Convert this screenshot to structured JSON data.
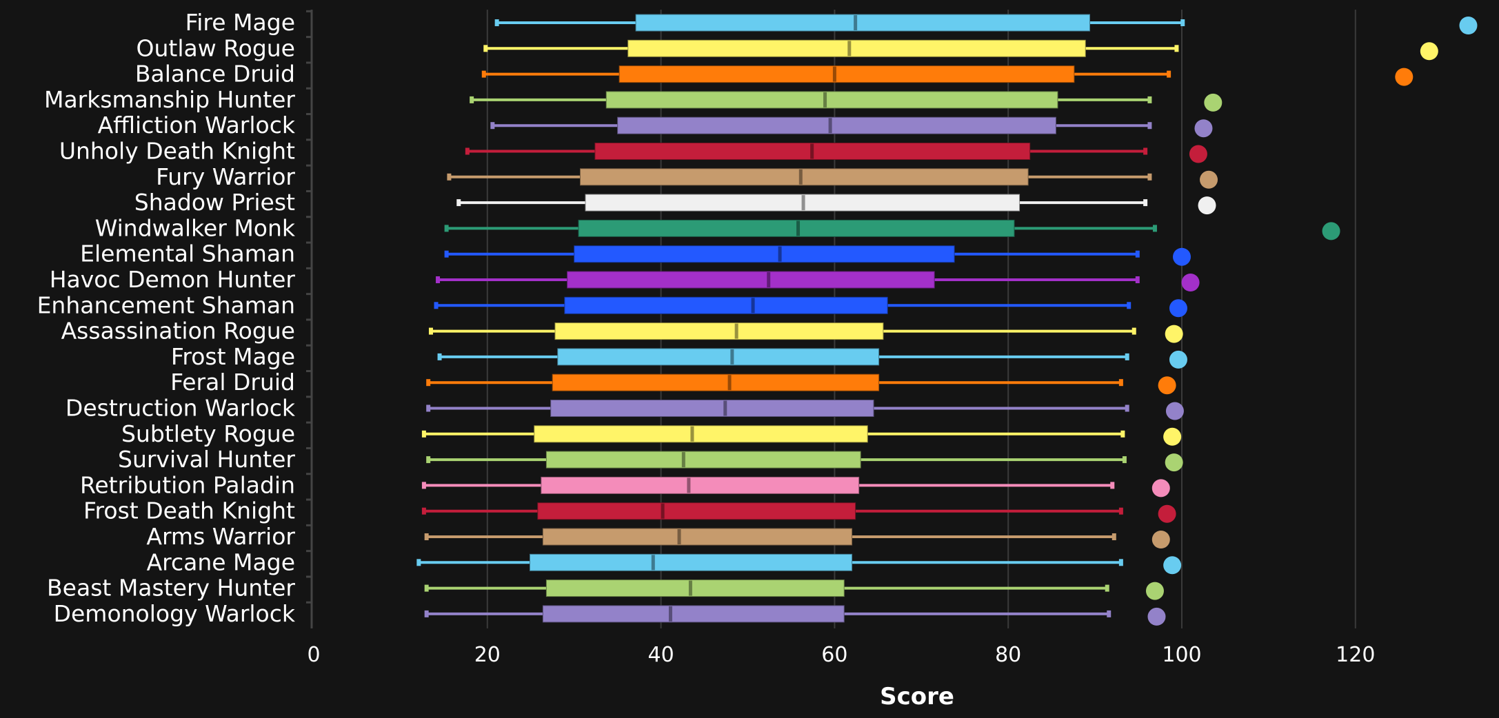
{
  "chart_data": {
    "type": "boxplot",
    "title": "",
    "xlabel": "Score",
    "ylabel": "",
    "xlim": [
      0,
      133
    ],
    "xticks": [
      0,
      20,
      40,
      60,
      80,
      100,
      120
    ],
    "grid": true,
    "legend": "none",
    "series": [
      {
        "name": "Fire Mage",
        "color": "#68ccf0",
        "min": 21.1,
        "q1": 37.1,
        "median": 62.4,
        "q3": 89.4,
        "max": 100.1,
        "outlier": 133.0
      },
      {
        "name": "Outlaw Rogue",
        "color": "#fff468",
        "min": 19.8,
        "q1": 36.2,
        "median": 61.7,
        "q3": 88.9,
        "max": 99.4,
        "outlier": 128.5
      },
      {
        "name": "Balance Druid",
        "color": "#ff7c0a",
        "min": 19.6,
        "q1": 35.2,
        "median": 60.0,
        "q3": 87.6,
        "max": 98.5,
        "outlier": 125.6
      },
      {
        "name": "Marksmanship Hunter",
        "color": "#aad372",
        "min": 18.2,
        "q1": 33.7,
        "median": 58.9,
        "q3": 85.7,
        "max": 96.3,
        "outlier": 103.6
      },
      {
        "name": "Affliction Warlock",
        "color": "#9382c9",
        "min": 20.6,
        "q1": 35.0,
        "median": 59.5,
        "q3": 85.5,
        "max": 96.3,
        "outlier": 102.5
      },
      {
        "name": "Unholy Death Knight",
        "color": "#c41e3b",
        "min": 17.7,
        "q1": 32.4,
        "median": 57.4,
        "q3": 82.5,
        "max": 95.8,
        "outlier": 101.9
      },
      {
        "name": "Fury Warrior",
        "color": "#c69b6d",
        "min": 15.6,
        "q1": 30.7,
        "median": 56.1,
        "q3": 82.3,
        "max": 96.3,
        "outlier": 103.1
      },
      {
        "name": "Shadow Priest",
        "color": "#f0f0f0",
        "min": 16.7,
        "q1": 31.3,
        "median": 56.4,
        "q3": 81.3,
        "max": 95.8,
        "outlier": 102.9
      },
      {
        "name": "Windwalker Monk",
        "color": "#2c9b76",
        "min": 15.3,
        "q1": 30.5,
        "median": 55.8,
        "q3": 80.7,
        "max": 96.9,
        "outlier": 117.2
      },
      {
        "name": "Elemental Shaman",
        "color": "#2359ff",
        "min": 15.3,
        "q1": 30.0,
        "median": 53.7,
        "q3": 73.8,
        "max": 94.9,
        "outlier": 100.0
      },
      {
        "name": "Havoc Demon Hunter",
        "color": "#a330c9",
        "min": 14.3,
        "q1": 29.2,
        "median": 52.4,
        "q3": 71.5,
        "max": 94.9,
        "outlier": 101.0
      },
      {
        "name": "Enhancement Shaman",
        "color": "#2359ff",
        "min": 14.1,
        "q1": 28.9,
        "median": 50.6,
        "q3": 66.1,
        "max": 93.9,
        "outlier": 99.6
      },
      {
        "name": "Assassination Rogue",
        "color": "#fff468",
        "min": 13.5,
        "q1": 27.8,
        "median": 48.7,
        "q3": 65.6,
        "max": 94.5,
        "outlier": 99.1
      },
      {
        "name": "Frost Mage",
        "color": "#68ccf0",
        "min": 14.5,
        "q1": 28.1,
        "median": 48.2,
        "q3": 65.1,
        "max": 93.7,
        "outlier": 99.6
      },
      {
        "name": "Feral Druid",
        "color": "#ff7c0a",
        "min": 13.2,
        "q1": 27.5,
        "median": 47.9,
        "q3": 65.1,
        "max": 93.0,
        "outlier": 98.3
      },
      {
        "name": "Destruction Warlock",
        "color": "#9382c9",
        "min": 13.2,
        "q1": 27.3,
        "median": 47.4,
        "q3": 64.5,
        "max": 93.7,
        "outlier": 99.2
      },
      {
        "name": "Subtlety Rogue",
        "color": "#fff468",
        "min": 12.7,
        "q1": 25.4,
        "median": 43.6,
        "q3": 63.8,
        "max": 93.2,
        "outlier": 98.9
      },
      {
        "name": "Survival Hunter",
        "color": "#aad372",
        "min": 13.2,
        "q1": 26.8,
        "median": 42.6,
        "q3": 63.0,
        "max": 93.4,
        "outlier": 99.1
      },
      {
        "name": "Retribution Paladin",
        "color": "#f48cba",
        "min": 12.7,
        "q1": 26.2,
        "median": 43.2,
        "q3": 62.8,
        "max": 92.0,
        "outlier": 97.6
      },
      {
        "name": "Frost Death Knight",
        "color": "#c41e3b",
        "min": 12.7,
        "q1": 25.8,
        "median": 40.2,
        "q3": 62.4,
        "max": 93.0,
        "outlier": 98.3
      },
      {
        "name": "Arms Warrior",
        "color": "#c69b6d",
        "min": 13.0,
        "q1": 26.4,
        "median": 42.1,
        "q3": 62.0,
        "max": 92.2,
        "outlier": 97.6
      },
      {
        "name": "Arcane Mage",
        "color": "#68ccf0",
        "min": 12.1,
        "q1": 24.9,
        "median": 39.1,
        "q3": 62.0,
        "max": 93.0,
        "outlier": 98.9
      },
      {
        "name": "Beast Mastery Hunter",
        "color": "#aad372",
        "min": 13.0,
        "q1": 26.8,
        "median": 43.4,
        "q3": 61.1,
        "max": 91.4,
        "outlier": 96.9
      },
      {
        "name": "Demonology Warlock",
        "color": "#9382c9",
        "min": 13.0,
        "q1": 26.4,
        "median": 41.1,
        "q3": 61.1,
        "max": 91.6,
        "outlier": 97.1
      }
    ]
  }
}
